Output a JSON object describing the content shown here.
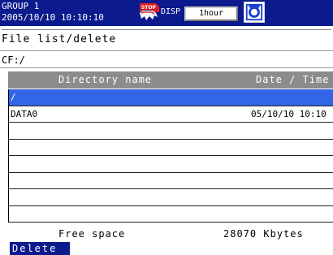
{
  "status": {
    "group": "GROUP 1",
    "datetime": "2005/10/10 10:10:10",
    "stop_badge_text": "STOP",
    "disp_label": "DISP",
    "interval": "1hour",
    "stop_icon": "stop-recording-icon",
    "media_icon": "memory-card-icon",
    "colors": {
      "bar": "#0b1a8c",
      "selected_row": "#3366e6",
      "header": "#8c8c8c"
    }
  },
  "page": {
    "title": "File list/delete",
    "path": "CF:/"
  },
  "table": {
    "headers": {
      "name": "Directory name",
      "date": "Date / Time"
    },
    "rows": [
      {
        "name": "/",
        "date": "",
        "selected": true
      },
      {
        "name": "DATA0",
        "date": "05/10/10 10:10",
        "selected": false
      },
      {
        "name": "",
        "date": ""
      },
      {
        "name": "",
        "date": ""
      },
      {
        "name": "",
        "date": ""
      },
      {
        "name": "",
        "date": ""
      },
      {
        "name": "",
        "date": ""
      },
      {
        "name": "",
        "date": ""
      }
    ]
  },
  "footer": {
    "free_label": "Free space",
    "free_value": "28070 Kbytes",
    "delete_label": "Delete"
  }
}
